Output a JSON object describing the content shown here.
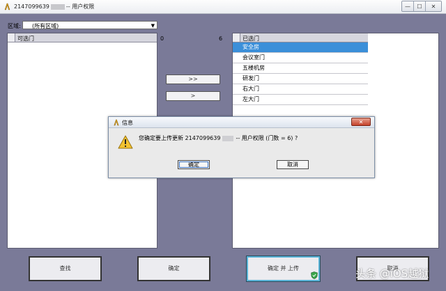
{
  "window": {
    "title_id": "2147099639",
    "title_suffix": "-- 用户权限",
    "minimize_label": "—",
    "maximize_label": "☐",
    "close_label": "✕"
  },
  "region": {
    "label": "区域:",
    "selected": "(所有区域)",
    "arrow": "▼"
  },
  "available": {
    "header": "可选门",
    "count": "0",
    "items": []
  },
  "selected_doors": {
    "header": "已选门",
    "count": "6",
    "items": [
      "安全房",
      "会议室门",
      "五楼机房",
      "研发门",
      "右大门",
      "左大门"
    ],
    "highlighted_index": 0
  },
  "transfer": {
    "add_all_label": ">>",
    "add_label": ">"
  },
  "dialog": {
    "title": "信息",
    "close_label": "✕",
    "message_prefix": "您确定要上传更新  2147099639",
    "message_suffix": "-- 用户权限 (门数 = 6) ?",
    "ok_label": "确定",
    "cancel_label": "取消"
  },
  "buttons": {
    "search_label": "查找",
    "confirm_label": "确定",
    "confirm_upload_label": "确定 并 上传",
    "cancel_label": "取消"
  },
  "watermark": "头条 @iOS越狱",
  "colors": {
    "background": "#7a7a98",
    "selection": "#3b8fd9",
    "warning": "#f2c230"
  }
}
